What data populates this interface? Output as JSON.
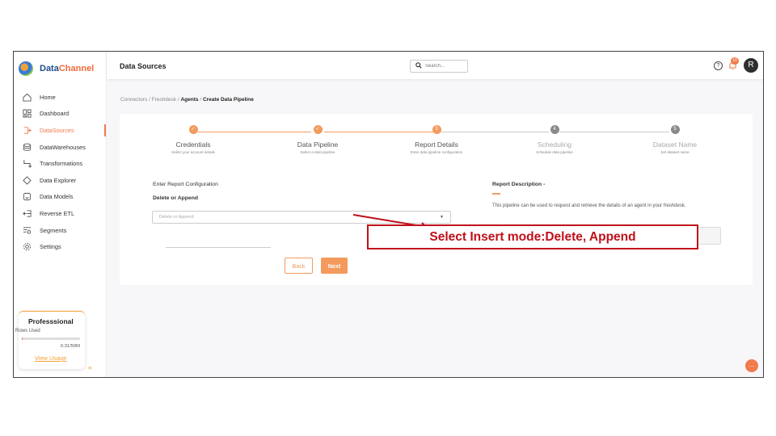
{
  "app": {
    "logo_part1": "Data",
    "logo_part2": "Channel"
  },
  "sidebar": {
    "items": [
      {
        "label": "Home",
        "icon": "home-icon"
      },
      {
        "label": "Dashboard",
        "icon": "dashboard-icon"
      },
      {
        "label": "DataSources",
        "icon": "datasource-icon",
        "active": true
      },
      {
        "label": "DataWarehouses",
        "icon": "database-icon"
      },
      {
        "label": "Transformations",
        "icon": "transform-icon"
      },
      {
        "label": "Data Explorer",
        "icon": "explorer-icon"
      },
      {
        "label": "Data Models",
        "icon": "model-icon"
      },
      {
        "label": "Reverse ETL",
        "icon": "reverse-etl-icon"
      },
      {
        "label": "Segments",
        "icon": "segments-icon"
      },
      {
        "label": "Settings",
        "icon": "gear-icon"
      }
    ],
    "plan": {
      "title": "Professsional",
      "rows_label": "Rows Used",
      "usage": "0.31/50M",
      "usage_fraction": 0.0062,
      "link": "View Usage"
    },
    "collapse_glyph": "«"
  },
  "header": {
    "title": "Data Sources",
    "search_placeholder": "Search...",
    "help_glyph": "?",
    "notification_count": "10",
    "avatar_initial": "R"
  },
  "breadcrumb": {
    "part1": "Connectors",
    "part2": "Freshdesk",
    "part3": "Agents",
    "part4": "Create Data Pipeline",
    "separator": "/"
  },
  "steps": [
    {
      "name": "Credentials",
      "desc": "Select your account details",
      "status": "done",
      "marker": "✓"
    },
    {
      "name": "Data Pipeline",
      "desc": "Select a data pipeline",
      "status": "done",
      "marker": "✓"
    },
    {
      "name": "Report Details",
      "desc": "Enter data pipeline configuration",
      "status": "current",
      "marker": "3"
    },
    {
      "name": "Scheduling",
      "desc": "Schedule data pipeline",
      "status": "pending",
      "marker": "4"
    },
    {
      "name": "Dataset Name",
      "desc": "Set dataset name",
      "status": "pending",
      "marker": "5"
    }
  ],
  "form": {
    "title": "Enter Report Configuration",
    "field_label": "Delete or Append",
    "select_placeholder": "Delete or Append",
    "back_label": "Back",
    "next_label": "Next"
  },
  "description": {
    "title": "Report Description -",
    "text": "This pipeline can be used to request and retrieve the details of an agent in your freshdesk."
  },
  "annotation": {
    "text": "Select Insert mode:Delete, Append",
    "color": "#c0101a"
  },
  "colors": {
    "accent": "#f39a5c",
    "brand_blue": "#1e4e8c"
  }
}
